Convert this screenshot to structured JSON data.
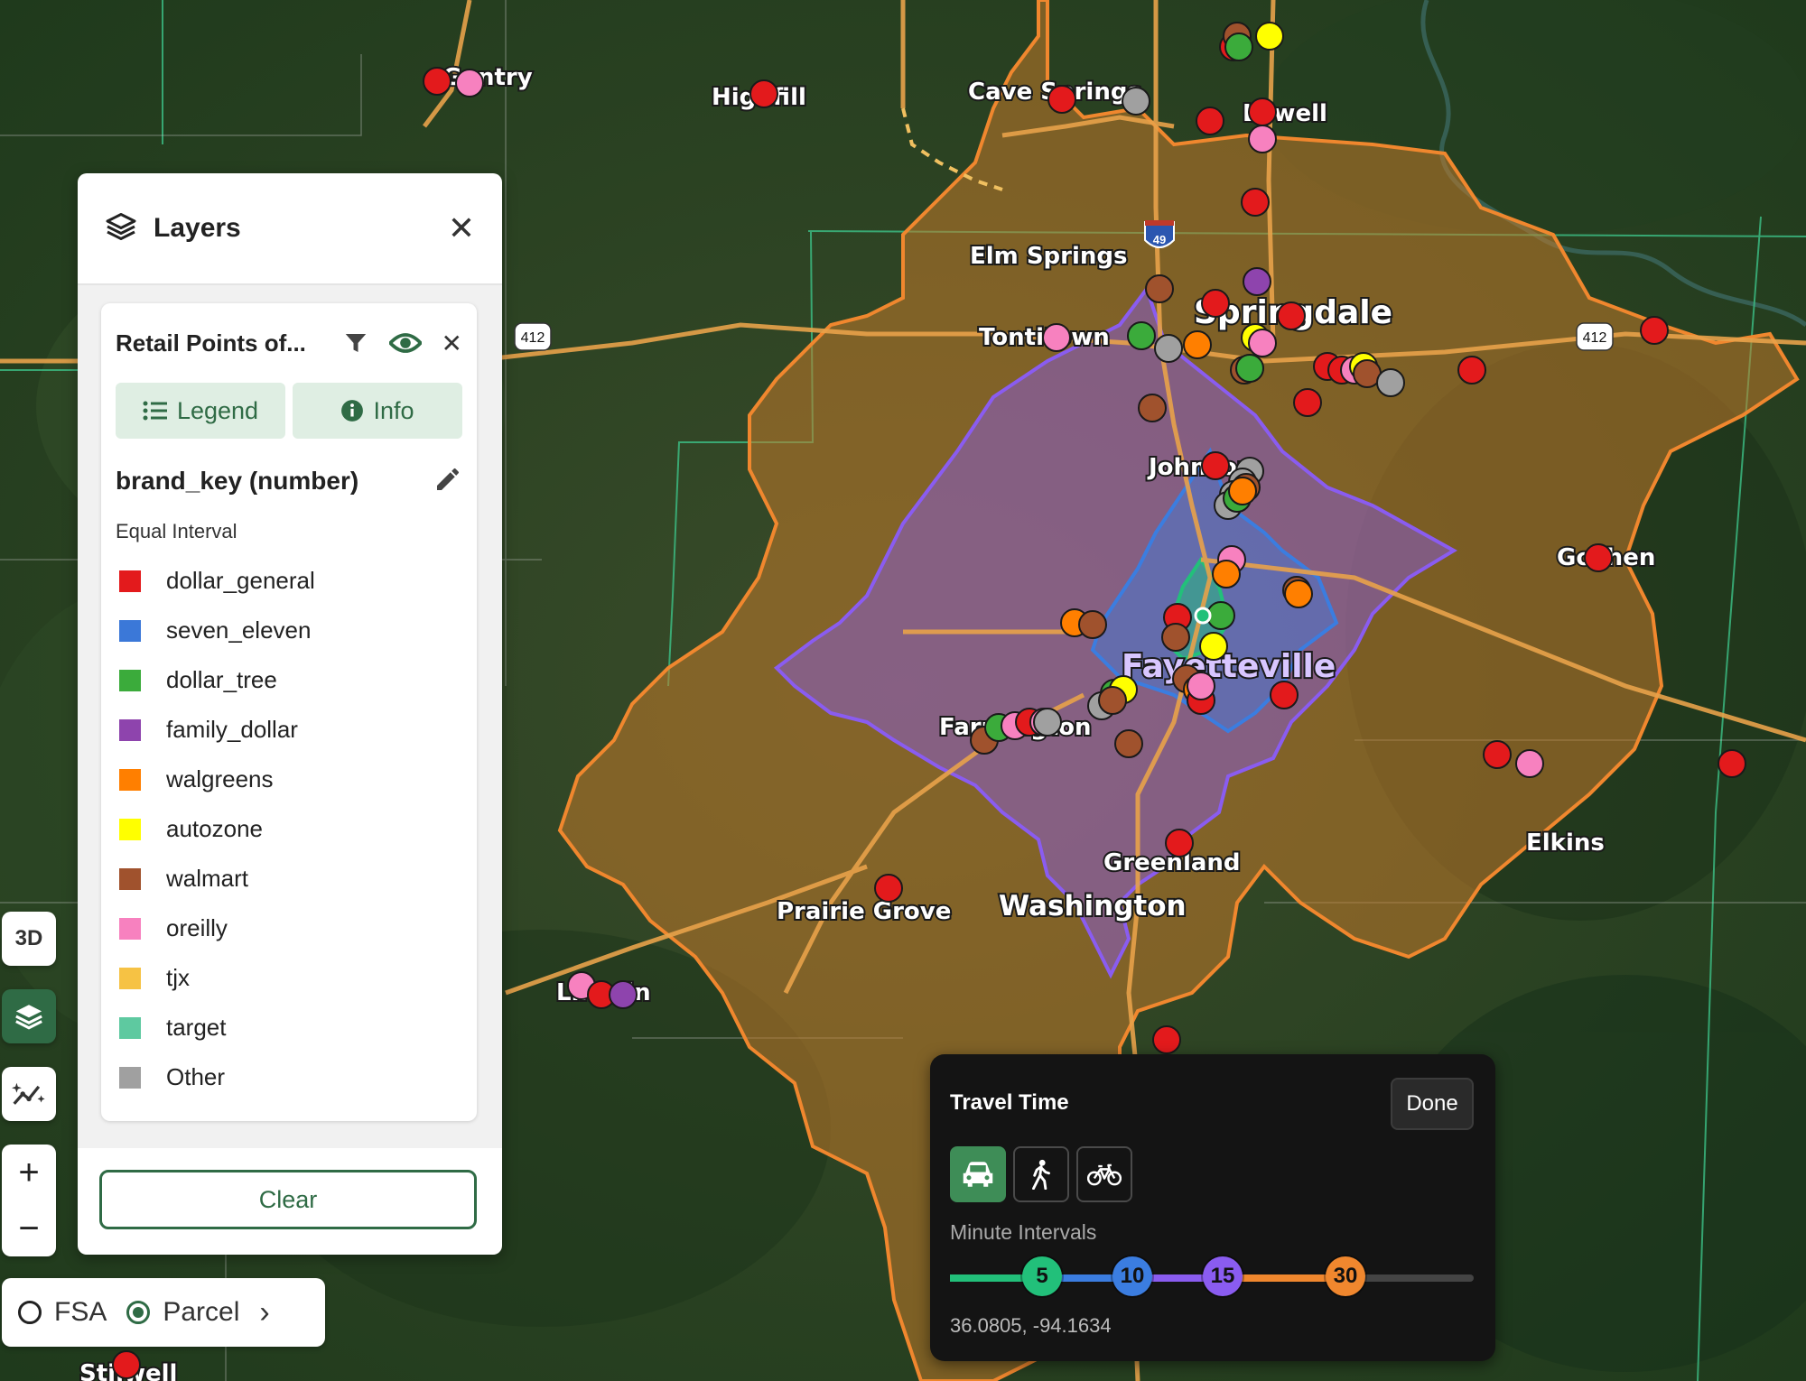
{
  "map": {
    "place_labels": [
      {
        "text": "Highfill"
      },
      {
        "text": "Cave Springs"
      },
      {
        "text": "Lowell"
      },
      {
        "text": "Elm Springs"
      },
      {
        "text": "Springdale"
      },
      {
        "text": "Tontitown"
      },
      {
        "text": "Johnson"
      },
      {
        "text": "Fayetteville"
      },
      {
        "text": "Farmington"
      },
      {
        "text": "Greenland"
      },
      {
        "text": "Prairie Grove"
      },
      {
        "text": "Washington"
      },
      {
        "text": "Elkins"
      },
      {
        "text": "Goshen"
      },
      {
        "text": "Stilwell"
      },
      {
        "text": "Lincoln"
      },
      {
        "text": "Gentry"
      }
    ],
    "road_shields": [
      "49",
      "412",
      "412"
    ],
    "isochrone_colors": {
      "min30": "#f0872e",
      "min15": "#8a5cf0",
      "min10": "#3b7de0",
      "min5": "#22c07a"
    },
    "center_marker_color": "#ffffff"
  },
  "layers_panel": {
    "title": "Layers",
    "close_icon": "close-icon",
    "layer": {
      "name": "Retail Points of...",
      "tabs": {
        "legend": "Legend",
        "info": "Info"
      },
      "attribute": "brand_key (number)",
      "classification": "Equal Interval",
      "legend": [
        {
          "label": "dollar_general",
          "color": "#e31a1c"
        },
        {
          "label": "seven_eleven",
          "color": "#3b78d8"
        },
        {
          "label": "dollar_tree",
          "color": "#3bab3b"
        },
        {
          "label": "family_dollar",
          "color": "#8e44ad"
        },
        {
          "label": "walgreens",
          "color": "#ff7f00"
        },
        {
          "label": "autozone",
          "color": "#ffff00"
        },
        {
          "label": "walmart",
          "color": "#a0522d"
        },
        {
          "label": "oreilly",
          "color": "#f781bf"
        },
        {
          "label": "tjx",
          "color": "#f6c244"
        },
        {
          "label": "target",
          "color": "#5ec9a0"
        },
        {
          "label": "Other",
          "color": "#a0a0a0"
        }
      ]
    },
    "clear_label": "Clear"
  },
  "controls": {
    "three_d_label": "3D"
  },
  "mode_selector": {
    "fsa_label": "FSA",
    "parcel_label": "Parcel",
    "selected": "Parcel"
  },
  "travel_time": {
    "title": "Travel Time",
    "done_label": "Done",
    "modes": [
      "drive",
      "walk",
      "bike"
    ],
    "active_mode": "drive",
    "intervals_label": "Minute Intervals",
    "intervals": [
      {
        "value": "5",
        "color": "#22c07a"
      },
      {
        "value": "10",
        "color": "#3b7de0"
      },
      {
        "value": "15",
        "color": "#8a5cf0"
      },
      {
        "value": "30",
        "color": "#f0872e"
      }
    ],
    "coordinates": "36.0805, -94.1634"
  }
}
